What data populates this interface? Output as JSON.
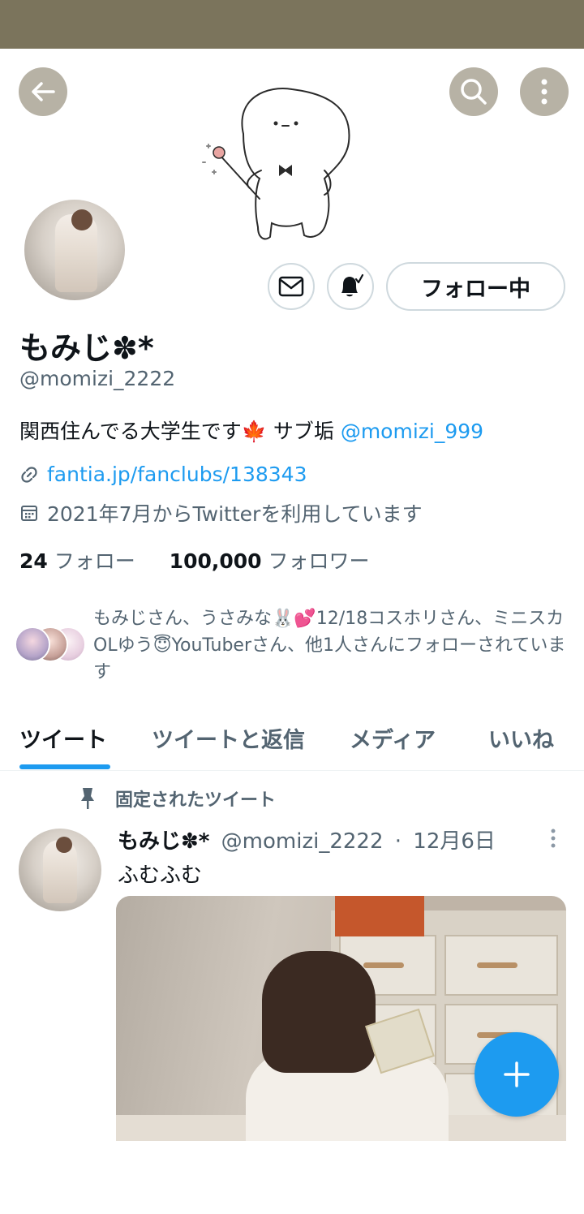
{
  "profile": {
    "display_name": "もみじ✽*",
    "handle": "@momizi_2222",
    "bio_text": "関西住んでる大学生です",
    "bio_emoji": "🍁",
    "bio_sub": " サブ垢 ",
    "bio_mention": "@momizi_999",
    "link": "fantia.jp/fanclubs/138343",
    "joined": "2021年7月からTwitterを利用しています",
    "following_count": "24",
    "following_label": "フォロー",
    "followers_count": "100,000",
    "followers_label": "フォロワー"
  },
  "actions": {
    "follow_label": "フォロー中"
  },
  "followed_by": {
    "text": "もみじさん、うさみな🐰💕12/18コスホリさん、ミニスカOLゆう😇YouTuberさん、他1人さんにフォローされています"
  },
  "tabs": [
    {
      "label": "ツイート"
    },
    {
      "label": "ツイートと返信"
    },
    {
      "label": "メディア"
    },
    {
      "label": "いいね"
    }
  ],
  "tweet": {
    "pinned_label": "固定されたツイート",
    "author_name": "もみじ✽*",
    "author_handle": "@momizi_2222",
    "separator": "·",
    "date": "12月6日",
    "text": "ふむふむ"
  },
  "colors": {
    "accent": "#1d9bf0",
    "status_bar": "#7b745c",
    "header_button": "#b7b2a5"
  },
  "icons": {
    "back": "arrow-left-icon",
    "search": "search-icon",
    "more": "more-vertical-icon",
    "mail": "mail-icon",
    "bell": "bell-subscribed-icon",
    "link": "link-icon",
    "calendar": "calendar-icon",
    "pin": "pin-icon",
    "compose": "plus-icon"
  }
}
